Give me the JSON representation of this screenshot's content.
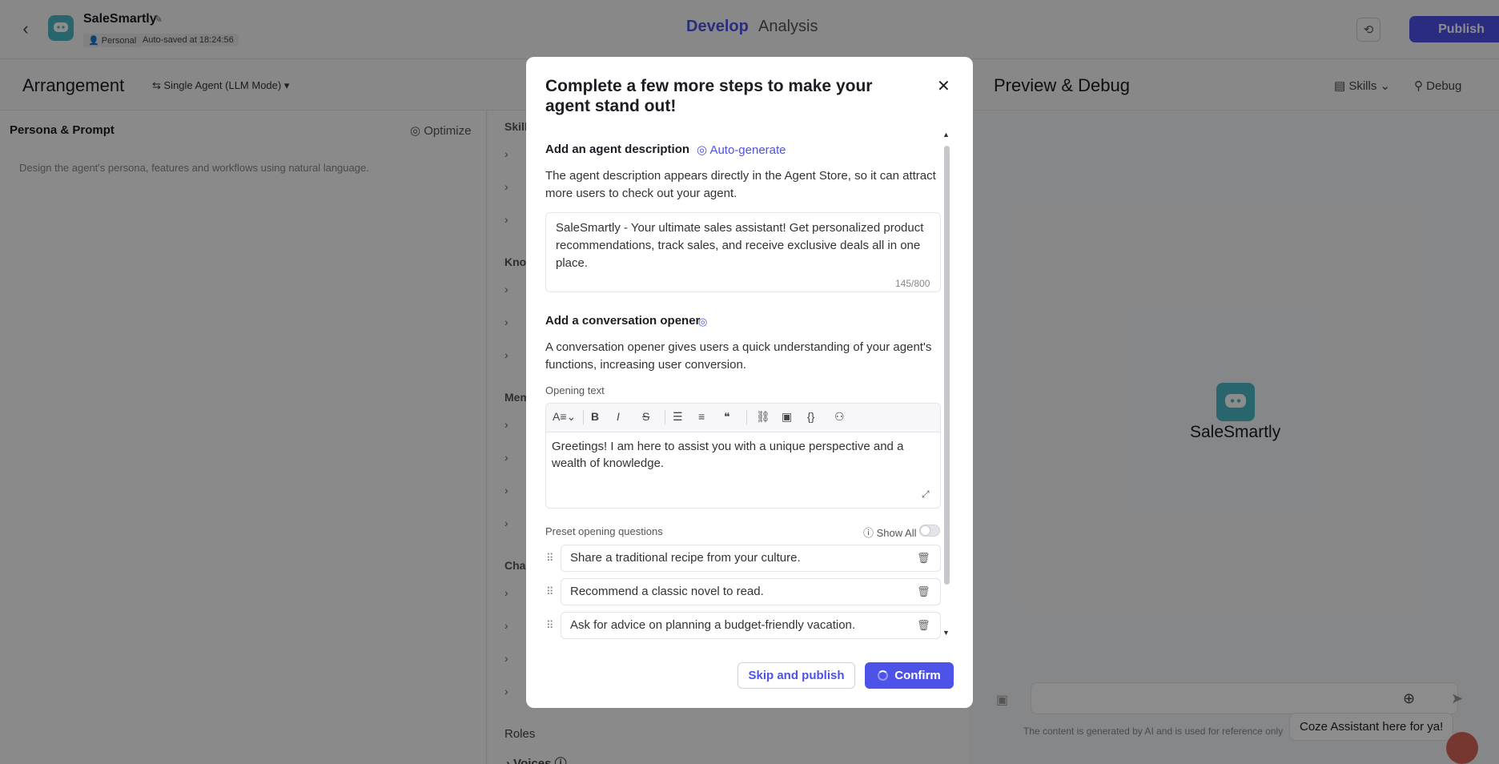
{
  "header": {
    "app_name": "SaleSmartly",
    "tag_personal": "Personal",
    "autosave": "Auto-saved at 18:24:56",
    "tabs": [
      "Develop",
      "Analysis"
    ],
    "publish_label": "Publish"
  },
  "subbar": {
    "arrangement": "Arrangement",
    "mode": "Single Agent (LLM Mode)",
    "preview_title": "Preview & Debug",
    "skills": "Skills",
    "debug": "Debug"
  },
  "left": {
    "persona_title": "Persona & Prompt",
    "optimize": "Optimize",
    "hint": "Design the agent's persona, features and workflows using natural language."
  },
  "mid": {
    "skills_label": "Skill",
    "knowledge_label": "Kno",
    "memory_label": "Mem",
    "chat_label": "Cha",
    "roles_label": "Roles",
    "voices_label": "Voices"
  },
  "right": {
    "bot_name": "SaleSmartly",
    "disclaimer": "The content is generated by AI and is used for reference only",
    "assistant_bubble": "Coze Assistant here for ya!"
  },
  "modal": {
    "title": "Complete a few more steps to make your agent stand out!",
    "desc_section_title": "Add an agent description",
    "autogenerate": "Auto-generate",
    "desc_help": "The agent description appears directly in the Agent Store, so it can attract more users to check out your agent.",
    "desc_value": "SaleSmartly - Your ultimate sales assistant! Get personalized product recommendations, track sales, and receive exclusive deals all in one place.",
    "desc_count": "145/800",
    "opener_section_title": "Add a conversation opener",
    "opener_help": "A conversation opener gives users a quick understanding of your agent's functions, increasing user conversion.",
    "opening_text_label": "Opening text",
    "opening_text": "Greetings! I am here to assist you with a unique perspective and a wealth of knowledge.",
    "preset_label": "Preset opening questions",
    "show_all": "Show All",
    "questions": [
      "Share a traditional recipe from your culture.",
      "Recommend a classic novel to read.",
      "Ask for advice on planning a budget-friendly vacation."
    ],
    "skip_label": "Skip and publish",
    "confirm_label": "Confirm"
  },
  "colors": {
    "accent": "#4d53e8",
    "avatar": "#4ab8c5"
  }
}
